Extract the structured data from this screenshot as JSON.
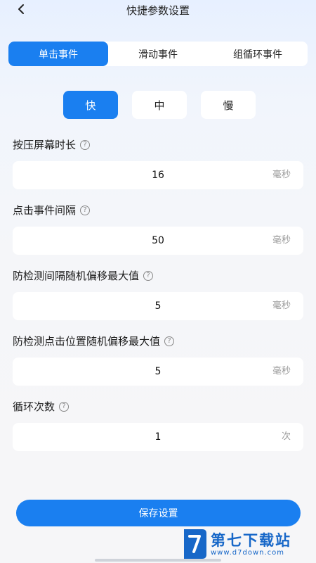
{
  "header": {
    "title": "快捷参数设置"
  },
  "tabs": [
    {
      "label": "单击事件",
      "active": true
    },
    {
      "label": "滑动事件",
      "active": false
    },
    {
      "label": "组循环事件",
      "active": false
    }
  ],
  "speed": [
    {
      "label": "快",
      "active": true
    },
    {
      "label": "中",
      "active": false
    },
    {
      "label": "慢",
      "active": false
    }
  ],
  "fields": [
    {
      "label": "按压屏幕时长",
      "value": "16",
      "unit": "毫秒"
    },
    {
      "label": "点击事件间隔",
      "value": "50",
      "unit": "毫秒"
    },
    {
      "label": "防检测间隔随机偏移最大值",
      "value": "5",
      "unit": "毫秒"
    },
    {
      "label": "防检测点击位置随机偏移最大值",
      "value": "5",
      "unit": "毫秒"
    },
    {
      "label": "循环次数",
      "value": "1",
      "unit": "次"
    }
  ],
  "help_glyph": "?",
  "save_label": "保存设置",
  "watermark": {
    "title": "第七下载站",
    "url": "www.d7down.com"
  },
  "colors": {
    "accent": "#1a7ff0",
    "brand": "#1767c8"
  }
}
